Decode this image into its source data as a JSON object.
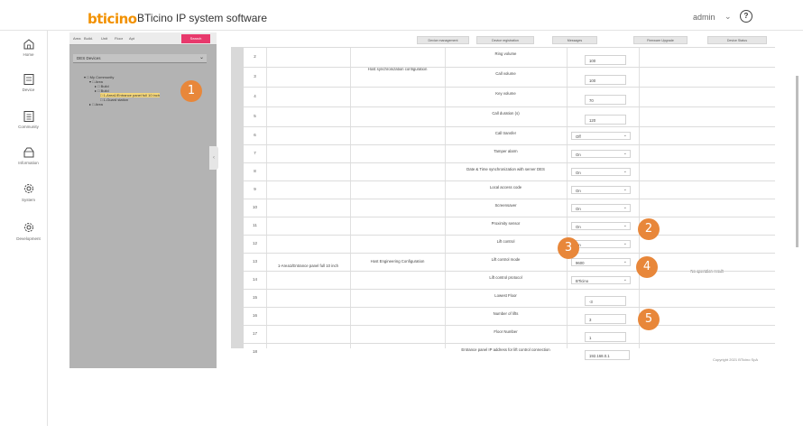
{
  "header": {
    "logo": "bticino",
    "app_title": "BTicino IP system software",
    "user": "admin",
    "help": "?"
  },
  "nav": [
    {
      "label": "Home",
      "icon": "home-icon"
    },
    {
      "label": "Device",
      "icon": "device-icon"
    },
    {
      "label": "Community",
      "icon": "community-icon"
    },
    {
      "label": "Information",
      "icon": "information-icon"
    },
    {
      "label": "System",
      "icon": "system-gear-icon"
    },
    {
      "label": "Development",
      "icon": "development-gear-icon"
    }
  ],
  "tree": {
    "filters": [
      "Area",
      "Build.",
      "Unit",
      "Floor",
      "Apt"
    ],
    "search_label": "Search",
    "select_value": "DES Devices",
    "nodes": [
      "My Community",
      "Area",
      "Build",
      "Build",
      "1-Area1/Entrance panel full 10 inch",
      "1-Guard station",
      "Area"
    ]
  },
  "toolbar": [
    "Device management",
    "Device registration",
    "Messages",
    "Firmware Upgrade",
    "Device Status"
  ],
  "rows": [
    {
      "n": "2",
      "param": "Ring volume",
      "value": "100"
    },
    {
      "n": "3",
      "param": "Call volume",
      "value": "100"
    },
    {
      "n": "4",
      "param": "Key volume",
      "value": "70"
    },
    {
      "n": "5",
      "param": "Call duration (s)",
      "value": "120"
    },
    {
      "n": "6",
      "param": "Call transfer",
      "value": "Off"
    },
    {
      "n": "7",
      "param": "Tamper alarm",
      "value": "On"
    },
    {
      "n": "8",
      "param": "Date & Time synchronization with server DES",
      "value": "On"
    },
    {
      "n": "9",
      "param": "Local access code",
      "value": "On"
    },
    {
      "n": "10",
      "param": "Screensaver",
      "value": "On"
    },
    {
      "n": "11",
      "param": "Proximity sensor",
      "value": "On"
    },
    {
      "n": "12",
      "param": "Lift control",
      "value": "On"
    },
    {
      "n": "13",
      "param": "Lift control mode",
      "value": "9600"
    },
    {
      "n": "14",
      "param": "Lift control protocol",
      "value": "BTicino"
    },
    {
      "n": "15",
      "param": "Lowest Floor",
      "value": "-3"
    },
    {
      "n": "16",
      "param": "Number of lifts",
      "value": "3"
    },
    {
      "n": "17",
      "param": "Floor Number",
      "value": "1"
    },
    {
      "n": "18",
      "param": "Entrance panel IP address for lift control connection",
      "value": "192.168.0.1"
    }
  ],
  "groups": {
    "host_sync": "Host synchronization configuration",
    "device": "1-Area1/Entrance panel full 10 inch",
    "host_eng": "Host Engineering Configuration",
    "result": "No operation result"
  },
  "badges": [
    "1",
    "2",
    "3",
    "4",
    "5"
  ],
  "footer": {
    "copyright": "Copyright 2021 BTicino SpA"
  },
  "colors": {
    "accent": "#e8873a",
    "search": "#e8396c",
    "highlight": "#f5d77a"
  }
}
